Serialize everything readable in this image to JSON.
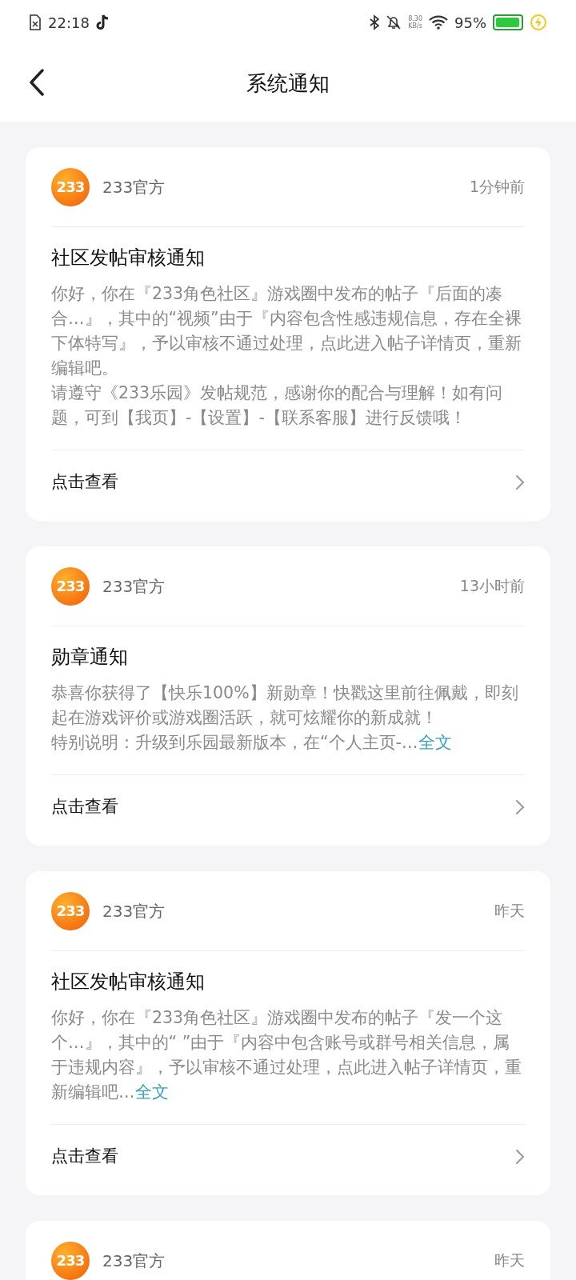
{
  "status_bar": {
    "time": "22:18",
    "net_speed": "8.30",
    "net_unit": "KB/s",
    "battery": "95%"
  },
  "header": {
    "title": "系统通知"
  },
  "notifications": [
    {
      "avatar_text": "233",
      "sender": "233官方",
      "time": "1分钟前",
      "title": "社区发帖审核通知",
      "body": [
        "你好，你在『233角色社区』游戏圈中发布的帖子『后面的凑合…』，其中的“视频”由于『内容包含性感违规信息，存在全裸下体特写』，予以审核不通过处理，点此进入帖子详情页，重新编辑吧。",
        "请遵守《233乐园》发帖规范，感谢你的配合与理解！如有问题，可到【我页】-【设置】-【联系客服】进行反馈哦！"
      ],
      "action": "点击查看"
    },
    {
      "avatar_text": "233",
      "sender": "233官方",
      "time": "13小时前",
      "title": "勋章通知",
      "body": [
        "恭喜你获得了【快乐100%】新勋章！快戳这里前往佩戴，即刻起在游戏评价或游戏圈活跃，就可炫耀你的新成就！",
        "特别说明：升级到乐园最新版本，在“个人主页-…"
      ],
      "more": "全文",
      "action": "点击查看"
    },
    {
      "avatar_text": "233",
      "sender": "233官方",
      "time": "昨天",
      "title": "社区发帖审核通知",
      "body": [
        "你好，你在『233角色社区』游戏圈中发布的帖子『发一个这个…』，其中的“ ”由于『内容中包含账号或群号相关信息，属于违规内容』，予以审核不通过处理，点此进入帖子详情页，重新编辑吧…"
      ],
      "more": "全文",
      "action": "点击查看"
    },
    {
      "avatar_text": "233",
      "sender": "233官方",
      "time": "昨天"
    }
  ]
}
